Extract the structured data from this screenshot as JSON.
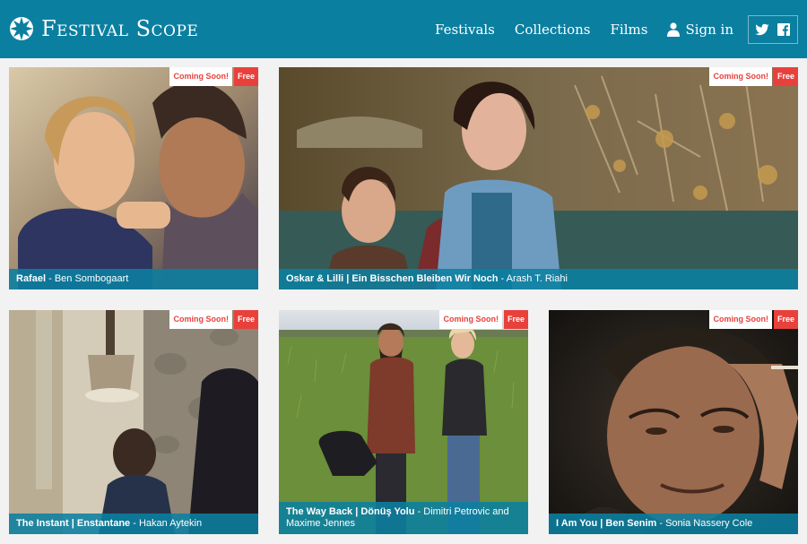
{
  "header": {
    "brand": "Festival Scope",
    "nav": {
      "festivals": "Festivals",
      "collections": "Collections",
      "films": "Films",
      "sign_in": "Sign in"
    },
    "social": [
      "twitter-icon",
      "facebook-icon"
    ],
    "colors": {
      "bar": "#0b7fa0",
      "badge_red": "#e8413c"
    }
  },
  "films": [
    {
      "title": "Rafael",
      "director": "Ben Sombogaart",
      "badge_status": "Coming Soon!",
      "badge_price": "Free"
    },
    {
      "title": "Oskar & Lilli | Ein Bisschen Bleiben Wir Noch",
      "director": "Arash T. Riahi",
      "badge_status": "Coming Soon!",
      "badge_price": "Free"
    },
    {
      "title": "The Instant | Enstantane",
      "director": "Hakan Aytekin",
      "badge_status": "Coming Soon!",
      "badge_price": "Free"
    },
    {
      "title": "The Way Back | Dönüş Yolu",
      "director": "Dimitri Petrovic and Maxime Jennes",
      "badge_status": "Coming Soon!",
      "badge_price": "Free"
    },
    {
      "title": "I Am You | Ben Senim",
      "director": "Sonia Nassery Cole",
      "badge_status": "Coming Soon!",
      "badge_price": "Free"
    }
  ]
}
